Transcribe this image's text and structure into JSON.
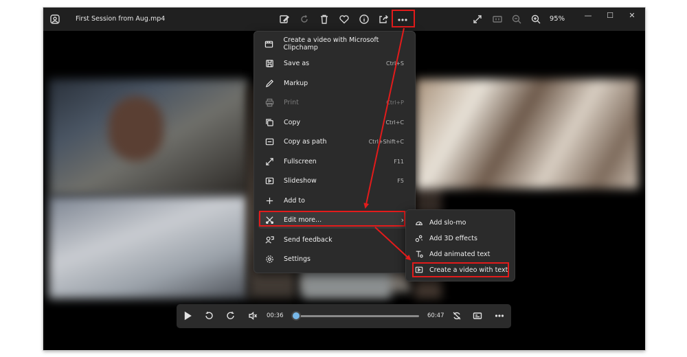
{
  "window": {
    "title": "First Session from Aug.mp4",
    "zoom": "95%",
    "toolbar_icons": [
      "edit-image-icon",
      "rotate-icon",
      "delete-icon",
      "favorite-icon",
      "info-icon",
      "share-icon",
      "more-icon"
    ],
    "right_icons": [
      "expand-icon",
      "actual-size-icon",
      "zoom-out-icon",
      "zoom-in-icon"
    ],
    "window_controls": {
      "minimize": "—",
      "maximize": "☐",
      "close": "✕"
    }
  },
  "menu": {
    "items": [
      {
        "label": "Create a video with Microsoft Clipchamp",
        "shortcut": "",
        "icon": "clipchamp-icon",
        "disabled": false
      },
      {
        "label": "Save as",
        "shortcut": "Ctrl+S",
        "icon": "save-icon",
        "disabled": false
      },
      {
        "label": "Markup",
        "shortcut": "",
        "icon": "markup-pen-icon",
        "disabled": false
      },
      {
        "label": "Print",
        "shortcut": "Ctrl+P",
        "icon": "print-icon",
        "disabled": true
      },
      {
        "label": "Copy",
        "shortcut": "Ctrl+C",
        "icon": "copy-icon",
        "disabled": false
      },
      {
        "label": "Copy as path",
        "shortcut": "Ctrl+Shift+C",
        "icon": "copy-path-icon",
        "disabled": false
      },
      {
        "label": "Fullscreen",
        "shortcut": "F11",
        "icon": "fullscreen-icon",
        "disabled": false
      },
      {
        "label": "Slideshow",
        "shortcut": "F5",
        "icon": "slideshow-icon",
        "disabled": false
      },
      {
        "label": "Add to",
        "shortcut": "",
        "icon": "plus-icon",
        "disabled": false
      },
      {
        "label": "Edit more...",
        "shortcut": "",
        "icon": "edit-more-icon",
        "disabled": false
      },
      {
        "label": "Send feedback",
        "shortcut": "",
        "icon": "feedback-icon",
        "disabled": false
      },
      {
        "label": "Settings",
        "shortcut": "",
        "icon": "settings-icon",
        "disabled": false
      }
    ]
  },
  "submenu": {
    "items": [
      {
        "label": "Add slo-mo",
        "icon": "slo-mo-icon"
      },
      {
        "label": "Add 3D effects",
        "icon": "3d-effects-icon"
      },
      {
        "label": "Add animated text",
        "icon": "animated-text-icon"
      },
      {
        "label": "Create a video with text",
        "icon": "video-text-icon"
      }
    ]
  },
  "player": {
    "current_time": "00:36",
    "total_time": "60:47",
    "progress": 0.01,
    "icons": [
      "play-icon",
      "rewind-10-icon",
      "forward-30-icon",
      "mute-icon",
      "repeat-icon",
      "subtitle-icon",
      "more-icon"
    ]
  },
  "colors": {
    "highlight": "#e31b1b",
    "menu_bg": "#2b2b2b",
    "titlebar_bg": "#202020",
    "progress_accent": "#78b7e8"
  }
}
